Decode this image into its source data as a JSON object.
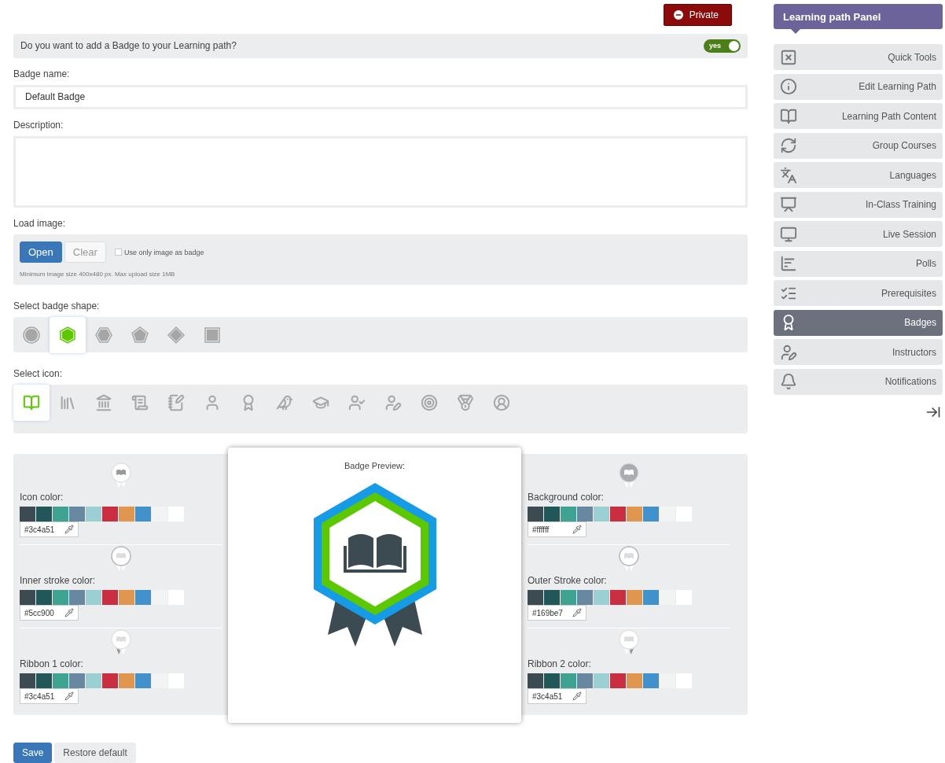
{
  "private_button": {
    "label": "Private"
  },
  "badge_question": {
    "label": "Do you want to add a Badge to your Learning path?",
    "toggle": {
      "label": "yes",
      "on": true
    }
  },
  "badge_name": {
    "label": "Badge name:",
    "value": "Default Badge"
  },
  "description": {
    "label": "Description:"
  },
  "load_image": {
    "label": "Load image:",
    "buttons": [
      {
        "label": "Open",
        "kind": "primary"
      },
      {
        "label": "Clear",
        "kind": "secondary"
      }
    ],
    "checkbox": {
      "label": "Use only image as badge",
      "checked": false
    },
    "hint": "Minimum image size 400x480 px. Max upload size 1MB"
  },
  "badge_shape": {
    "label": "Select badge shape:",
    "shapes": [
      {
        "kind": "circle",
        "selected": false
      },
      {
        "kind": "hexagon",
        "selected": true
      },
      {
        "kind": "hexagon-flat",
        "selected": false
      },
      {
        "kind": "pentagon",
        "selected": false
      },
      {
        "kind": "diamond",
        "selected": false
      },
      {
        "kind": "square",
        "selected": false
      }
    ]
  },
  "icon_select": {
    "label": "Select icon:",
    "icons": [
      {
        "kind": "book",
        "selected": true
      },
      {
        "kind": "books",
        "selected": false
      },
      {
        "kind": "building",
        "selected": false
      },
      {
        "kind": "diploma",
        "selected": false
      },
      {
        "kind": "document",
        "selected": false
      },
      {
        "kind": "person",
        "selected": false
      },
      {
        "kind": "laurel",
        "selected": false
      },
      {
        "kind": "owl",
        "selected": false
      },
      {
        "kind": "cap",
        "selected": false
      },
      {
        "kind": "graduate",
        "selected": false
      },
      {
        "kind": "teacher",
        "selected": false
      },
      {
        "kind": "target",
        "selected": false
      },
      {
        "kind": "medal",
        "selected": false
      },
      {
        "kind": "manager",
        "selected": false
      }
    ]
  },
  "palette": [
    {
      "color": "#3c4a51"
    },
    {
      "color": "#22575a"
    },
    {
      "color": "#3ea391"
    },
    {
      "color": "#6887a0"
    },
    {
      "color": "#9acfd4"
    },
    {
      "color": "#c92f40"
    },
    {
      "color": "#e0964f"
    },
    {
      "color": "#4091cc"
    },
    {
      "color": "#f2f3f3"
    },
    {
      "color": "#ffffff"
    }
  ],
  "color_settings_left": [
    {
      "kind": "icon",
      "label": "Icon color:",
      "value": "#3c4a51"
    },
    {
      "kind": "inner_stroke",
      "label": "Inner stroke color:",
      "value": "#5cc900"
    },
    {
      "kind": "ribbon1",
      "label": "Ribbon 1 color:",
      "value": "#3c4a51"
    }
  ],
  "preview": {
    "title": "Badge Preview:"
  },
  "color_settings_right": [
    {
      "kind": "background",
      "label": "Background color:",
      "value": "#ffffff"
    },
    {
      "kind": "outer_stroke",
      "label": "Outer Stroke color:",
      "value": "#169be7"
    },
    {
      "kind": "ribbon2",
      "label": "Ribbon 2 color:",
      "value": "#3c4a51"
    }
  ],
  "actions": [
    {
      "label": "Save",
      "kind": "primary"
    },
    {
      "label": "Restore default",
      "kind": "secondary"
    }
  ],
  "sidebar": {
    "title": "Learning path Panel",
    "items": [
      {
        "label": "Quick Tools",
        "selected": false
      },
      {
        "label": "Edit Learning Path",
        "selected": false
      },
      {
        "label": "Learning Path Content",
        "selected": false
      },
      {
        "label": "Group Courses",
        "selected": false
      },
      {
        "label": "Languages",
        "selected": false
      },
      {
        "label": "In-Class Training",
        "selected": false
      },
      {
        "label": "Live Session",
        "selected": false
      },
      {
        "label": "Polls",
        "selected": false
      },
      {
        "label": "Prerequisites",
        "selected": false
      },
      {
        "label": "Badges",
        "selected": true
      },
      {
        "label": "Instructors",
        "selected": false
      },
      {
        "label": "Notifications",
        "selected": false
      }
    ]
  }
}
